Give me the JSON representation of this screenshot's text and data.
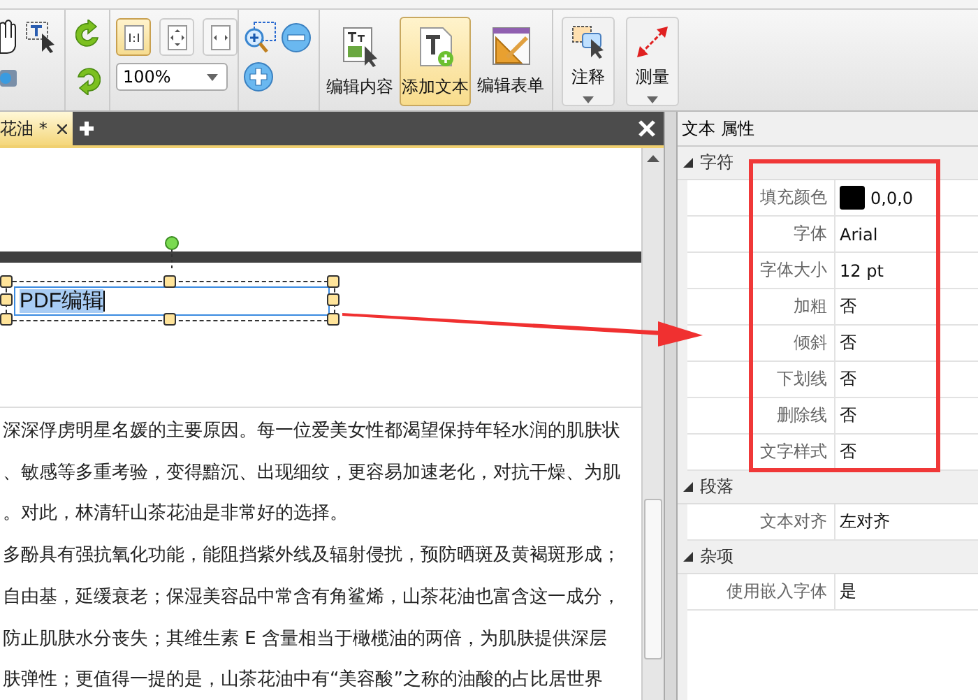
{
  "toolbar": {
    "fit_buttons": [
      {
        "selected": true
      },
      {
        "selected": false
      },
      {
        "selected": false
      }
    ],
    "zoom": {
      "value": "100%"
    },
    "large_buttons": [
      {
        "label": "编辑内容",
        "selected": false,
        "kind": "edit-content"
      },
      {
        "label": "添加文本",
        "selected": true,
        "kind": "add-text"
      },
      {
        "label": "编辑表单",
        "selected": false,
        "kind": "edit-form"
      }
    ],
    "dropdown_buttons": [
      {
        "label": "注释",
        "kind": "comment"
      },
      {
        "label": "测量",
        "kind": "measure"
      }
    ]
  },
  "tabs": [
    {
      "label": "花油 *",
      "selected": true
    }
  ],
  "document": {
    "text_box": {
      "value": "PDF编辑"
    },
    "lines": [
      "深深俘虏明星名媛的主要原因。每一位爱美女性都渴望保持年轻水润的肌肤状",
      "、敏感等多重考验，变得黯沉、出现细纹，更容易加速老化，对抗干燥、为肌",
      "。对此，林清轩山茶花油是非常好的选择。",
      "多酚具有强抗氧化功能，能阻挡紫外线及辐射侵扰，预防晒斑及黄褐斑形成；",
      "自由基，延缓衰老；保湿美容品中常含有角鲨烯，山茶花油也富含这一成分，",
      "防止肌肤水分丧失；其维生素 E 含量相当于橄榄油的两倍，为肌肤提供深层",
      "肤弹性；更值得一提的是，山茶花油中有“美容酸”之称的油酸的占比居世界"
    ]
  },
  "panel": {
    "title": "文本 属性",
    "sections": [
      {
        "title": "字符",
        "expanded": true,
        "rows": [
          {
            "label": "填充颜色",
            "value": "0,0,0",
            "color": "#000000"
          },
          {
            "label": "字体",
            "value": "Arial"
          },
          {
            "label": "字体大小",
            "value": "12 pt"
          },
          {
            "label": "加粗",
            "value": "否"
          },
          {
            "label": "倾斜",
            "value": "否"
          },
          {
            "label": "下划线",
            "value": "否"
          },
          {
            "label": "删除线",
            "value": "否"
          },
          {
            "label": "文字样式",
            "value": "否"
          }
        ]
      },
      {
        "title": "段落",
        "expanded": true,
        "rows": [
          {
            "label": "文本对齐",
            "value": "左对齐"
          }
        ]
      },
      {
        "title": "杂项",
        "expanded": true,
        "rows": [
          {
            "label": "使用嵌入字体",
            "value": "是"
          }
        ]
      }
    ]
  }
}
